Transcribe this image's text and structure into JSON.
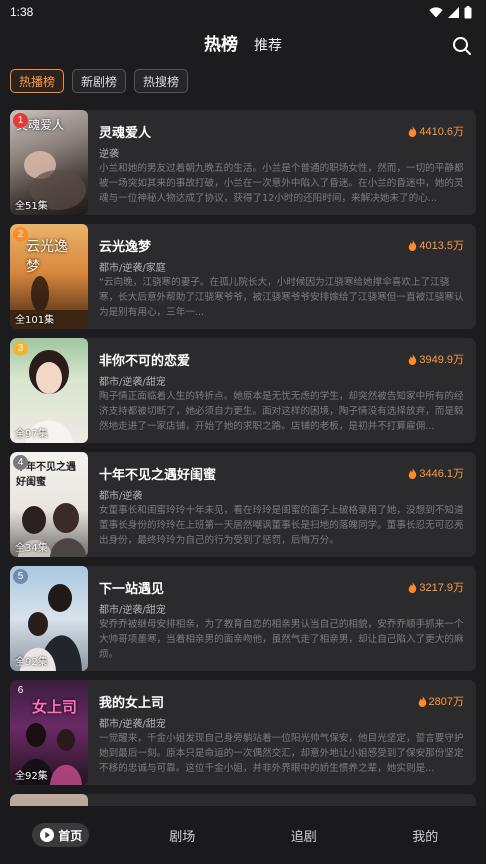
{
  "status_bar": {
    "time": "1:38"
  },
  "header": {
    "tabs": [
      {
        "label": "热榜"
      },
      {
        "label": "推荐"
      }
    ]
  },
  "chips": [
    {
      "label": "热播榜"
    },
    {
      "label": "新剧榜"
    },
    {
      "label": "热搜榜"
    }
  ],
  "items": [
    {
      "rank": "1",
      "poster_text": "灵魂爱人",
      "episodes": "全51集",
      "title": "灵魂爱人",
      "heat": "4410.6万",
      "tags": "逆袭",
      "desc": "小兰和她的男友过着朝九晚五的生活。小兰是个普通的职场女性，然而，一切的平静都被一场突如其来的事故打破，小兰在一次意外中陷入了昏迷。在小兰的昏迷中，她的灵魂与一位神秘人物达成了协议，获得了12小时的还阳时间，来解决她未了的心..."
    },
    {
      "rank": "2",
      "poster_text": "云光逸梦",
      "episodes": "全101集",
      "title": "云光逸梦",
      "heat": "4013.5万",
      "tags": "都市/逆袭/家庭",
      "desc": "“云向晚，江骁寒的妻子。在孤儿院长大，小时候因为江骁寒给她撑伞喜欢上了江骁寒，长大后意外帮助了江骁寒爷爷，被江骁寒爷爷安排嫁给了江骁寒但一直被江骁寒认为是别有用心，三年一..."
    },
    {
      "rank": "3",
      "poster_text": "",
      "episodes": "全97集",
      "title": "非你不可的恋爱",
      "heat": "3949.9万",
      "tags": "都市/逆袭/甜宠",
      "desc": "陶子情正面临着人生的转折点。她原本是无忧无虑的学生，却突然被告知家中所有的经济支持都被切断了，她必须自力更生。面对这样的困境，陶子情没有选择放弃，而是毅然地走进了一家店铺，开始了她的求职之路。店铺的老板，是初并不打算雇佣..."
    },
    {
      "rank": "4",
      "poster_text": "十年不见之遇好闺蜜",
      "episodes": "全34集",
      "title": "十年不见之遇好闺蜜",
      "heat": "3446.1万",
      "tags": "都市/逆袭",
      "desc": "女董事长和闺蜜玲玲十年未见，看在玲玲是闺蜜的面子上破格录用了她，没想到不知道董事长身份的玲玲在上班第一天居然嘲讽董事长是扫地的落魄同学。董事长忍无可忍亮出身份，最终玲玲为自己的行为受到了惩罚，后悔万分。"
    },
    {
      "rank": "5",
      "poster_text": "",
      "episodes": "全92集",
      "title": "下一站遇见",
      "heat": "3217.9万",
      "tags": "都市/逆袭/甜宠",
      "desc": "安乔乔被继母安排相亲，为了教育自恋的相亲男认当自己的相貌，安乔乔顺手抓来一个大帅哥项墨寒，当着相亲男的面亲吻他，虽然气走了相亲男，却让自己陷入了更大的麻烦。"
    },
    {
      "rank": "6",
      "poster_text": "女上司",
      "episodes": "全92集",
      "title": "我的女上司",
      "heat": "2807万",
      "tags": "都市/逆袭/甜宠",
      "desc": "一觉醒来，千金小姐发现自己身旁躺站着一位阳光帅气保安，他目光坚定，誓言要守护她到最后一刻。原本只是命运的一次偶然交汇，却意外地让小姐感受到了保安那份坚定不移的忠诚与可靠。这位千金小姐，并非外界眼中的娇生惯养之辈，她实则是..."
    }
  ],
  "bottom_nav": [
    {
      "label": "首页"
    },
    {
      "label": "剧场"
    },
    {
      "label": "追剧"
    },
    {
      "label": "我的"
    }
  ],
  "colors": {
    "accent": "#ff9a3c",
    "background": "#1c1c1e",
    "card": "#2b2b2e"
  }
}
